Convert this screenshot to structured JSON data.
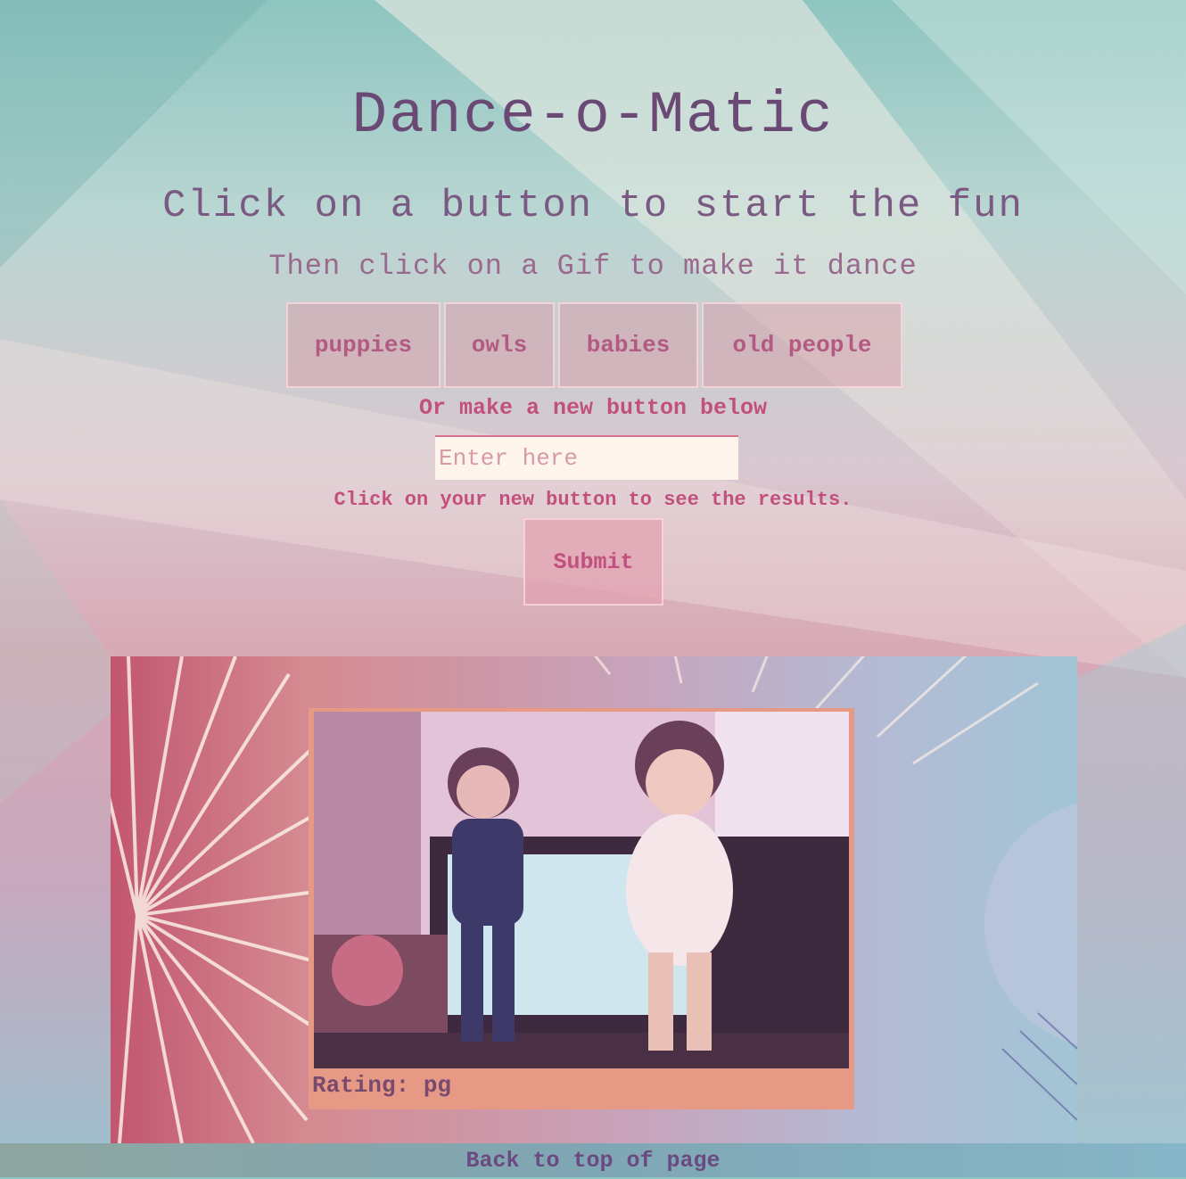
{
  "header": {
    "title": "Dance-o-Matic",
    "subtitle": "Click on a button to start the fun",
    "instruction": "Then click on a Gif to make it dance"
  },
  "topics": [
    {
      "label": "puppies"
    },
    {
      "label": "owls"
    },
    {
      "label": "babies"
    },
    {
      "label": "old people"
    }
  ],
  "form": {
    "prompt": "Or make a new button below",
    "input_placeholder": "Enter here",
    "hint": "Click on your new button to see the results.",
    "submit_label": "Submit"
  },
  "results": {
    "gifs": [
      {
        "rating_label": "Rating: pg"
      }
    ]
  },
  "footer": {
    "back_to_top": "Back to top of page"
  },
  "colors": {
    "title": "#6a4a74",
    "accent": "#c2507e",
    "card": "#e69a86"
  }
}
